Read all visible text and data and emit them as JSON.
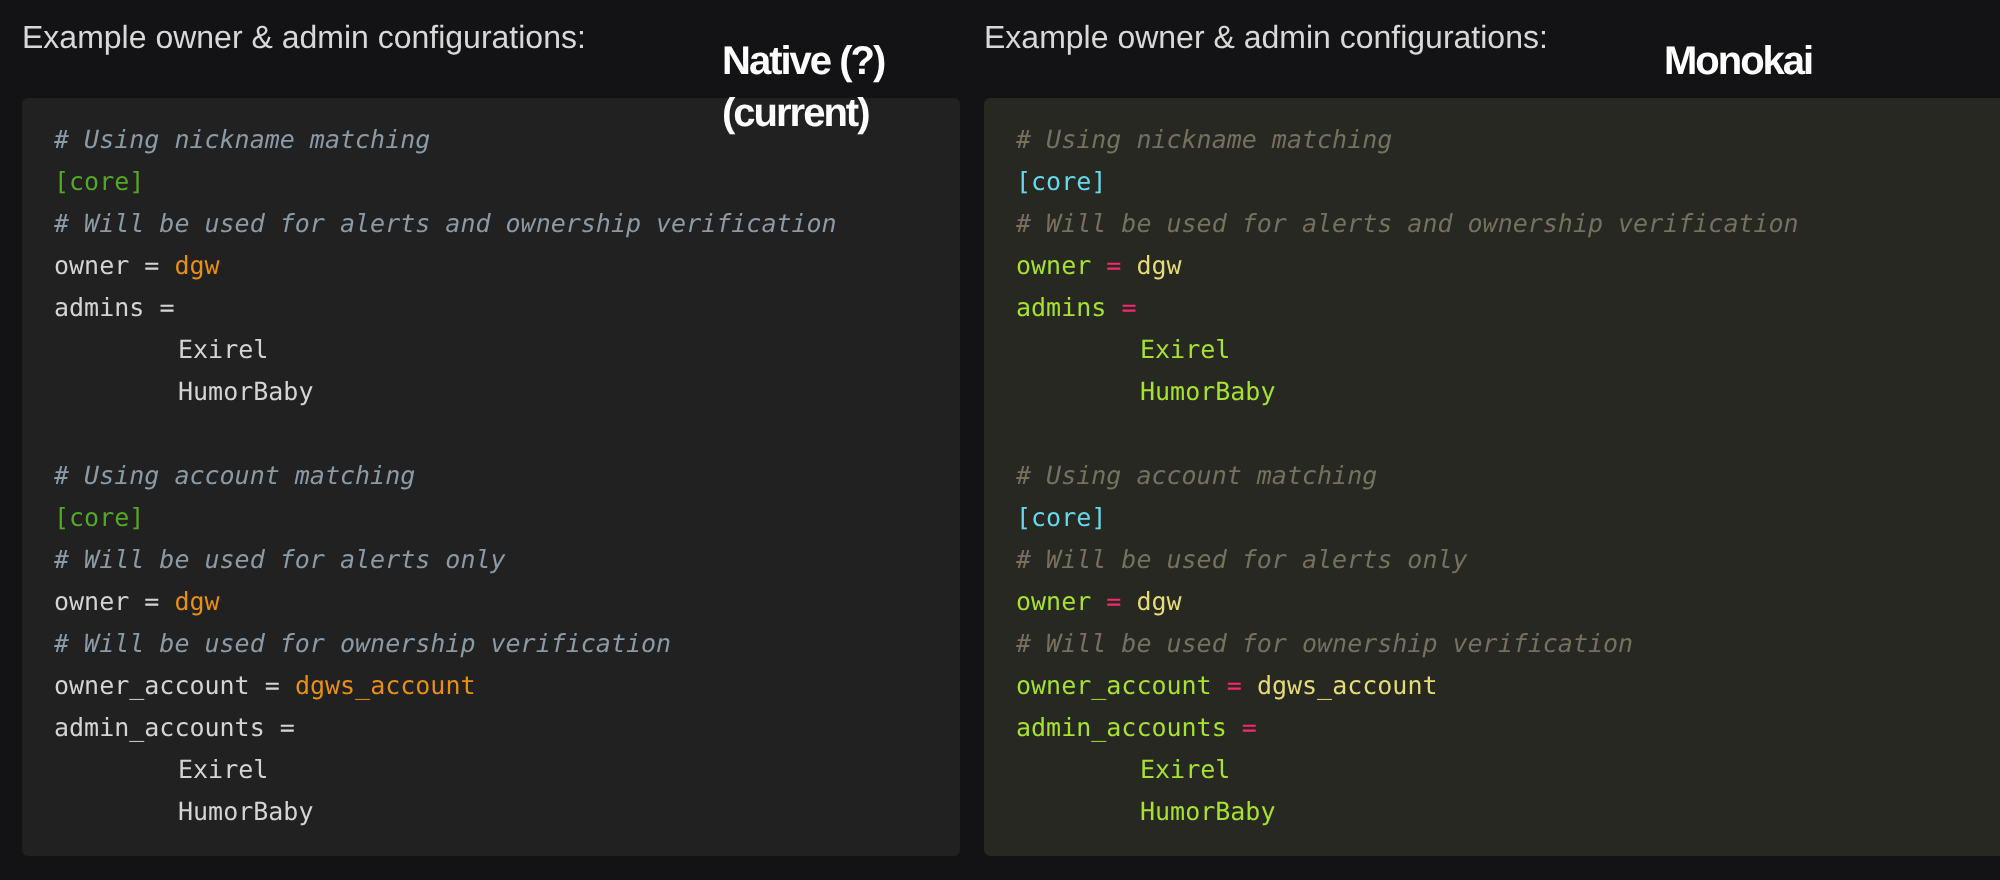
{
  "panels": [
    {
      "heading": "Example owner & admin configurations:",
      "kind": "native",
      "caption": [
        "Native (?)",
        "(current)"
      ],
      "lines": [
        {
          "kind": "code",
          "tokens": [
            {
              "kind": "comment",
              "text": "# Using nickname matching"
            }
          ]
        },
        {
          "kind": "code",
          "tokens": [
            {
              "kind": "section",
              "text": "[core]"
            }
          ]
        },
        {
          "kind": "code",
          "tokens": [
            {
              "kind": "comment",
              "text": "# Will be used for alerts and ownership verification"
            }
          ]
        },
        {
          "kind": "code",
          "tokens": [
            {
              "kind": "key",
              "text": "owner"
            },
            {
              "kind": "op",
              "text": "="
            },
            {
              "kind": "value",
              "text": "dgw"
            }
          ]
        },
        {
          "kind": "code",
          "tokens": [
            {
              "kind": "key",
              "text": "admins"
            },
            {
              "kind": "op",
              "text": "="
            }
          ]
        },
        {
          "kind": "entry",
          "tokens": [
            {
              "kind": "name",
              "text": "Exirel"
            }
          ]
        },
        {
          "kind": "entry",
          "tokens": [
            {
              "kind": "name",
              "text": "HumorBaby"
            }
          ]
        },
        {
          "kind": "blank"
        },
        {
          "kind": "code",
          "tokens": [
            {
              "kind": "comment",
              "text": "# Using account matching"
            }
          ]
        },
        {
          "kind": "code",
          "tokens": [
            {
              "kind": "section",
              "text": "[core]"
            }
          ]
        },
        {
          "kind": "code",
          "tokens": [
            {
              "kind": "comment",
              "text": "# Will be used for alerts only"
            }
          ]
        },
        {
          "kind": "code",
          "tokens": [
            {
              "kind": "key",
              "text": "owner"
            },
            {
              "kind": "op",
              "text": "="
            },
            {
              "kind": "value",
              "text": "dgw"
            }
          ]
        },
        {
          "kind": "code",
          "tokens": [
            {
              "kind": "comment",
              "text": "# Will be used for ownership verification"
            }
          ]
        },
        {
          "kind": "code",
          "tokens": [
            {
              "kind": "key",
              "text": "owner_account"
            },
            {
              "kind": "op",
              "text": "="
            },
            {
              "kind": "value",
              "text": "dgws_account"
            }
          ]
        },
        {
          "kind": "code",
          "tokens": [
            {
              "kind": "key",
              "text": "admin_accounts"
            },
            {
              "kind": "op",
              "text": "="
            }
          ]
        },
        {
          "kind": "entry",
          "tokens": [
            {
              "kind": "name",
              "text": "Exirel"
            }
          ]
        },
        {
          "kind": "entry",
          "tokens": [
            {
              "kind": "name",
              "text": "HumorBaby"
            }
          ]
        }
      ]
    },
    {
      "heading": "Example owner & admin configurations:",
      "kind": "monokai",
      "caption": [
        "Monokai"
      ],
      "lines": [
        {
          "kind": "code",
          "tokens": [
            {
              "kind": "comment",
              "text": "# Using nickname matching"
            }
          ]
        },
        {
          "kind": "code",
          "tokens": [
            {
              "kind": "section",
              "text": "[core]"
            }
          ]
        },
        {
          "kind": "code",
          "tokens": [
            {
              "kind": "comment",
              "text": "# Will be used for alerts and ownership verification"
            }
          ]
        },
        {
          "kind": "code",
          "tokens": [
            {
              "kind": "key",
              "text": "owner"
            },
            {
              "kind": "op",
              "text": "="
            },
            {
              "kind": "value",
              "text": "dgw"
            }
          ]
        },
        {
          "kind": "code",
          "tokens": [
            {
              "kind": "key",
              "text": "admins"
            },
            {
              "kind": "op",
              "text": "="
            }
          ]
        },
        {
          "kind": "entry",
          "tokens": [
            {
              "kind": "name",
              "text": "Exirel"
            }
          ]
        },
        {
          "kind": "entry",
          "tokens": [
            {
              "kind": "name",
              "text": "HumorBaby"
            }
          ]
        },
        {
          "kind": "blank"
        },
        {
          "kind": "code",
          "tokens": [
            {
              "kind": "comment",
              "text": "# Using account matching"
            }
          ]
        },
        {
          "kind": "code",
          "tokens": [
            {
              "kind": "section",
              "text": "[core]"
            }
          ]
        },
        {
          "kind": "code",
          "tokens": [
            {
              "kind": "comment",
              "text": "# Will be used for alerts only"
            }
          ]
        },
        {
          "kind": "code",
          "tokens": [
            {
              "kind": "key",
              "text": "owner"
            },
            {
              "kind": "op",
              "text": "="
            },
            {
              "kind": "value",
              "text": "dgw"
            }
          ]
        },
        {
          "kind": "code",
          "tokens": [
            {
              "kind": "comment",
              "text": "# Will be used for ownership verification"
            }
          ]
        },
        {
          "kind": "code",
          "tokens": [
            {
              "kind": "key",
              "text": "owner_account"
            },
            {
              "kind": "op",
              "text": "="
            },
            {
              "kind": "value",
              "text": "dgws_account"
            }
          ]
        },
        {
          "kind": "code",
          "tokens": [
            {
              "kind": "key",
              "text": "admin_accounts"
            },
            {
              "kind": "op",
              "text": "="
            }
          ]
        },
        {
          "kind": "entry",
          "tokens": [
            {
              "kind": "name",
              "text": "Exirel"
            }
          ]
        },
        {
          "kind": "entry",
          "tokens": [
            {
              "kind": "name",
              "text": "HumorBaby"
            }
          ]
        }
      ]
    }
  ]
}
